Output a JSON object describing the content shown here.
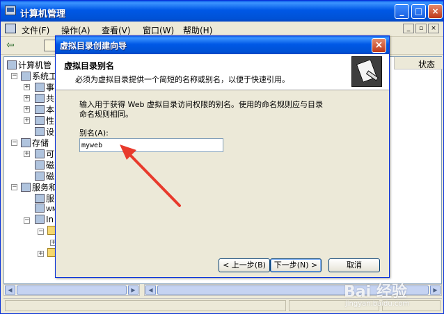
{
  "window": {
    "title": "计算机管理"
  },
  "menu": {
    "items": [
      "文件(F)",
      "操作(A)",
      "查看(V)",
      "窗口(W)",
      "帮助(H)"
    ]
  },
  "tree": {
    "root": "计算机管",
    "items": [
      "系统工",
      "事",
      "共",
      "本",
      "性",
      "设",
      "存储",
      "可",
      "磁",
      "磁",
      "服务和",
      "服",
      "WM",
      "In"
    ]
  },
  "right_pane": {
    "column_status": "状态"
  },
  "dialog": {
    "title": "虚拟目录创建向导",
    "header_title": "虚拟目录别名",
    "header_subtitle": "必须为虚拟目录提供一个简短的名称或别名，以便于快速引用。",
    "description": "输入用于获得 Web 虚拟目录访问权限的别名。使用的命名规则应与目录命名规则相同。",
    "alias_label": "别名(A):",
    "alias_value": "myweb",
    "back_button": "< 上一步(B)",
    "next_button": "下一步(N) >",
    "cancel_button": "取消"
  },
  "watermark": {
    "logo": "Bai 经验",
    "url": "jingyan.baidu.com"
  },
  "colors": {
    "xp_blue": "#0058e6",
    "arrow_red": "#e83a2c",
    "dialog_bg": "#ece9d8"
  }
}
